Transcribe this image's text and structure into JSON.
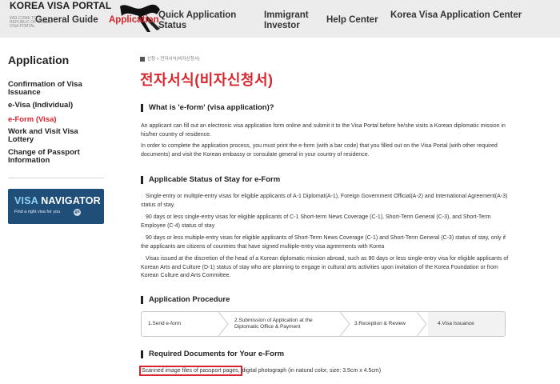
{
  "header": {
    "logo_title": "KOREA VISA PORTAL",
    "logo_sub": "WELCOME TO REPUBLIC OF KOREA VISA PORTAL",
    "nav": [
      {
        "label": "General Guide"
      },
      {
        "label": "Application"
      },
      {
        "label": "Quick Application Status"
      },
      {
        "label": "Immigrant Investor"
      },
      {
        "label": "Help Center"
      },
      {
        "label": "Korea Visa Application Center"
      }
    ],
    "active_color": "#d7262d"
  },
  "sidebar": {
    "title": "Application",
    "items": [
      {
        "label": "Confirmation of Visa Issuance"
      },
      {
        "label": "e-Visa (Individual)"
      },
      {
        "label": "e-Form (Visa)"
      },
      {
        "label": "Work and Visit Visa Lottery"
      },
      {
        "label": "Change of Passport Information"
      }
    ],
    "active_index": 2,
    "visa_navigator": {
      "title_a": "VISA",
      "title_b": " NAVIGATOR",
      "subtitle": "Find a right visa for you",
      "badge": "go"
    }
  },
  "breadcrumb": {
    "items": [
      "신청",
      "전자서식(비자신청서)"
    ],
    "separator": ">"
  },
  "page_title": "전자서식(비자신청서)",
  "sections": {
    "what": {
      "heading": "What is 'e-form' (visa application)?",
      "para1": "An applicant can fill out an electronic visa application form online and submit it to the Visa Portal before he/she visits a Korean diplomatic mission in his/her country of residence.",
      "para2": "In order to complete the application process, you must print the e-form (with a bar code) that you filled out on the Visa Portal (with other required documents) and visit the Korean embassy or consulate general in your country of residence."
    },
    "status": {
      "heading": "Applicable Status of Stay for e-Form",
      "bullets": [
        "Single-entry or multiple-entry visas for eligible applicants of A-1 Diplomat(A-1), Foreign Government Official(A-2) and International Agreement(A-3) status of stay.",
        "90 days or less single-entry visas for eligible applicants of C-1 Short-term News Coverage (C-1), Short-Term General (C-3), and Short-Term Employee (C-4) status of stay",
        "90 days or less multiple-entry visas for eligible applicants of Short-Term News Coverage (C-1) and Short-Term General (C-3) status of stay, only if the applicants are citizens of countries that have signed multiple-entry visa agreements with Korea",
        "Visas issued at the discretion of the head of a Korean diplomatic mission abroad, such as 90 days or less single-entry visa for eligible applicants of Korean Arts and Culture (D-1) status of stay who are planning to engage in cultural arts activities upon invitation of the Korea Foundation or from Korean Culture and Arts Committee."
      ]
    },
    "procedure": {
      "heading": "Application Procedure",
      "steps": [
        "1.Send e-form",
        "2.Submission of Application at the Diplomatic Office & Payment",
        "3.Reception & Review",
        "4.Visa Issuance"
      ]
    },
    "required": {
      "heading": "Required Documents for Your e-Form",
      "highlight": "Scanned image files of passport pages,",
      "rest": " digital photograph (in natural color, size: 3.5cm x 4.5cm)"
    }
  }
}
